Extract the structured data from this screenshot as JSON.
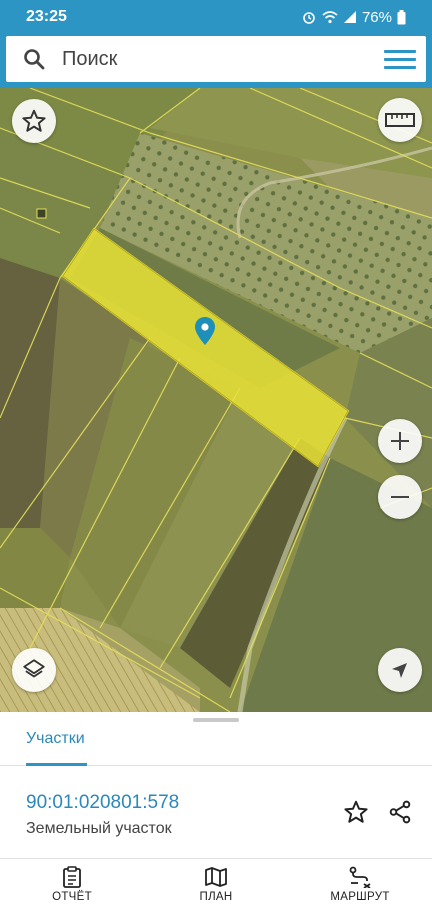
{
  "status_bar": {
    "time": "23:25",
    "battery": "76%"
  },
  "search": {
    "placeholder": "Поиск"
  },
  "map": {
    "icons": [
      "star-outline-icon",
      "ruler-icon",
      "zoom-in-icon",
      "zoom-out-icon",
      "layers-icon",
      "navigation-arrow-icon",
      "location-pin-icon"
    ],
    "highlight_color": "#e8e336"
  },
  "sheet": {
    "tab_label": "Участки",
    "parcel": {
      "number": "90:01:020801:578",
      "type": "Земельный участок"
    }
  },
  "nav": {
    "report": "ОТЧЁТ",
    "plan": "ПЛАН",
    "route": "МАРШРУТ"
  },
  "colors": {
    "accent": "#2c95c4",
    "link": "#2c88b8"
  }
}
